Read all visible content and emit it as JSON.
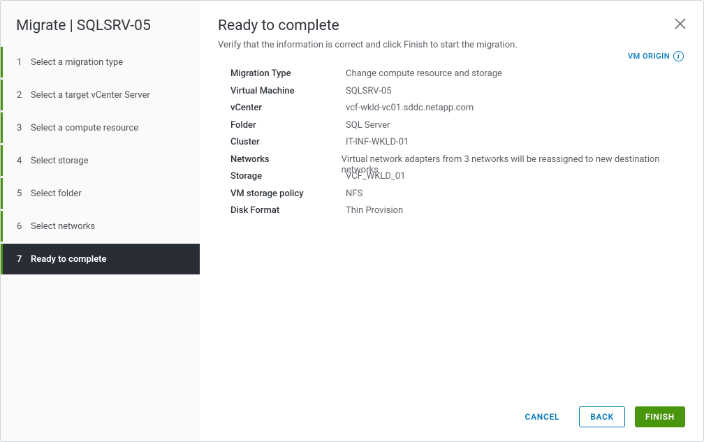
{
  "wizard_title": "Migrate | SQLSRV-05",
  "steps": [
    {
      "num": "1",
      "label": "Select a migration type"
    },
    {
      "num": "2",
      "label": "Select a target vCenter Server"
    },
    {
      "num": "3",
      "label": "Select a compute resource"
    },
    {
      "num": "4",
      "label": "Select storage"
    },
    {
      "num": "5",
      "label": "Select folder"
    },
    {
      "num": "6",
      "label": "Select networks"
    },
    {
      "num": "7",
      "label": "Ready to complete"
    }
  ],
  "page": {
    "title": "Ready to complete",
    "subtitle": "Verify that the information is correct and click Finish to start the migration.",
    "origin_label": "VM ORIGIN"
  },
  "summary": [
    {
      "label": "Migration Type",
      "value": "Change compute resource and storage"
    },
    {
      "label": "Virtual Machine",
      "value": "SQLSRV-05"
    },
    {
      "label": "vCenter",
      "value": "vcf-wkld-vc01.sddc.netapp.com"
    },
    {
      "label": "Folder",
      "value": "SQL Server"
    },
    {
      "label": "Cluster",
      "value": "IT-INF-WKLD-01"
    },
    {
      "label": "Networks",
      "value": "Virtual network adapters from 3 networks will be reassigned to new destination networks"
    },
    {
      "label": "Storage",
      "value": "VCF_WKLD_01"
    },
    {
      "label": "VM storage policy",
      "value": "NFS"
    },
    {
      "label": "Disk Format",
      "value": "Thin Provision"
    }
  ],
  "footer": {
    "cancel": "CANCEL",
    "back": "BACK",
    "finish": "FINISH"
  }
}
